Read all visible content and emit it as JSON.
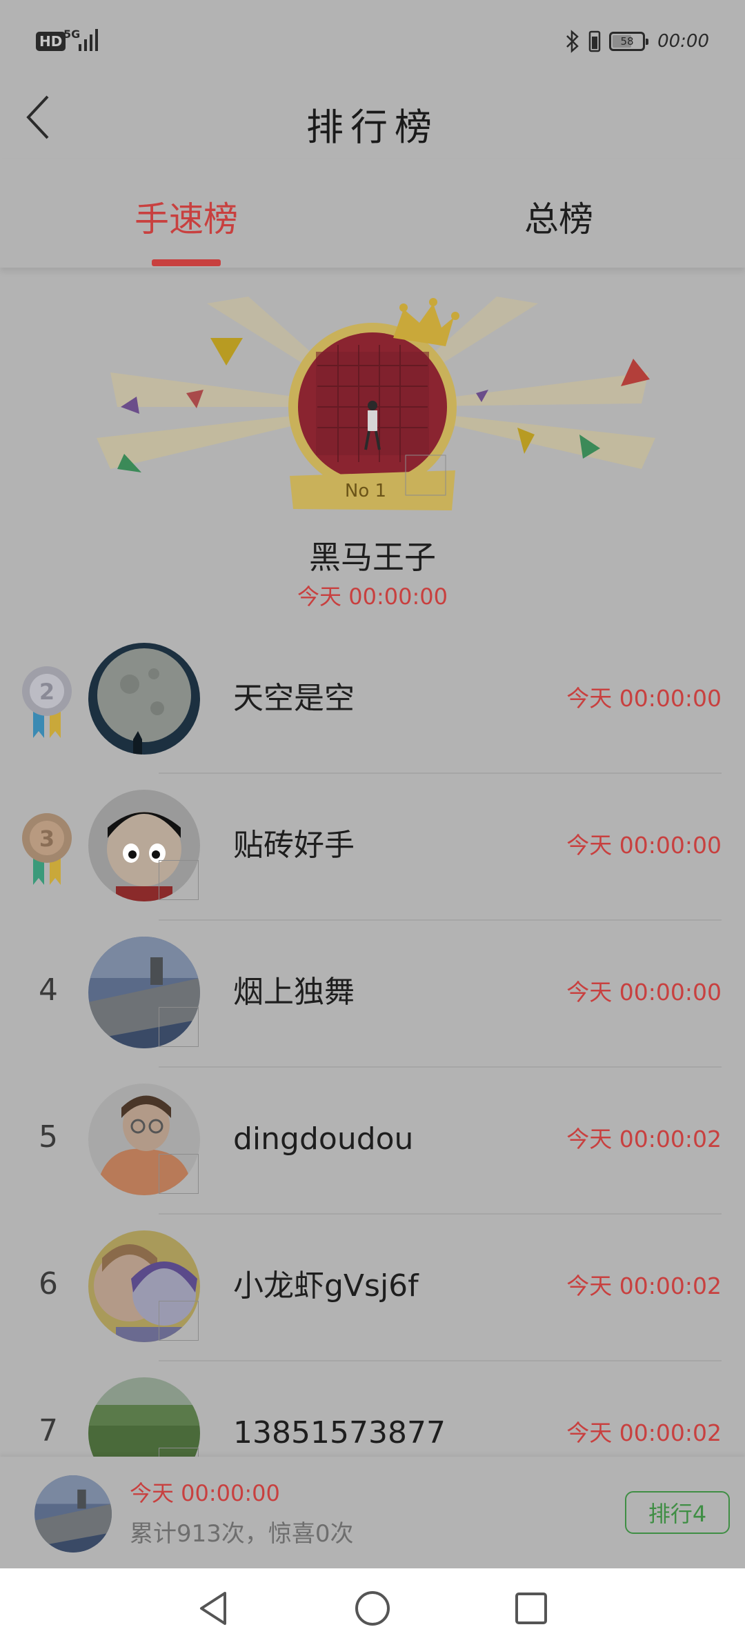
{
  "status_bar": {
    "hd": "HD",
    "network": "5G",
    "battery_level": "58",
    "time": "00:00"
  },
  "header": {
    "title": "排行榜"
  },
  "tabs": [
    {
      "label": "手速榜",
      "active": true
    },
    {
      "label": "总榜",
      "active": false
    }
  ],
  "champion": {
    "badge": "No 1",
    "name": "黑马王子",
    "time": "今天 00:00:00"
  },
  "rankings": [
    {
      "rank": "2",
      "name": "天空是空",
      "time": "今天 00:00:00"
    },
    {
      "rank": "3",
      "name": "贴砖好手",
      "time": "今天 00:00:00"
    },
    {
      "rank": "4",
      "name": "烟上独舞",
      "time": "今天 00:00:00"
    },
    {
      "rank": "5",
      "name": "dingdoudou",
      "time": "今天 00:00:02"
    },
    {
      "rank": "6",
      "name": "小龙虾gVsj6f",
      "time": "今天 00:00:02"
    },
    {
      "rank": "7",
      "name": "13851573877",
      "time": "今天 00:00:02"
    }
  ],
  "my_rank": {
    "time": "今天 00:00:00",
    "stats": "累计913次，惊喜0次",
    "rank_label": "排行4"
  },
  "colors": {
    "accent": "#c8403f",
    "badge_green": "#3f8e44",
    "background": "#b3b3b3"
  }
}
